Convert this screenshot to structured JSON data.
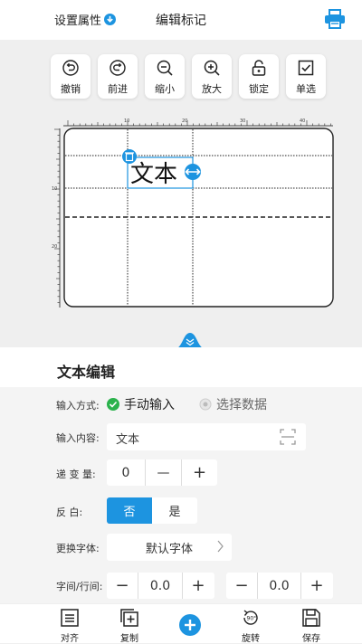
{
  "header": {
    "settings_label": "设置属性",
    "title": "编辑标记"
  },
  "toolbar": [
    {
      "label": "撤销",
      "icon": "undo-icon"
    },
    {
      "label": "前进",
      "icon": "redo-icon"
    },
    {
      "label": "缩小",
      "icon": "zoom-out-icon"
    },
    {
      "label": "放大",
      "icon": "zoom-in-icon"
    },
    {
      "label": "锁定",
      "icon": "lock-icon"
    },
    {
      "label": "单选",
      "icon": "checkbox-icon"
    }
  ],
  "ruler": {
    "top_ticks": [
      "10",
      "20",
      "30",
      "40"
    ],
    "left_ticks": [
      "10",
      "20"
    ]
  },
  "canvas": {
    "text_element": "文本"
  },
  "panel": {
    "title": "文本编辑",
    "input_mode_label": "输入方式:",
    "input_mode_options": [
      "手动输入",
      "选择数据"
    ],
    "input_mode_selected": "手动输入",
    "content_label": "输入内容:",
    "content_value": "文本",
    "increment_label": "递 变 量:",
    "increment_value": "0",
    "invert_label": "反    白:",
    "invert_options": [
      "否",
      "是"
    ],
    "invert_selected": "否",
    "font_label": "更换字体:",
    "font_value": "默认字体",
    "spacing_label": "字间/行间:",
    "char_spacing_value": "0.0",
    "line_spacing_value": "0.0"
  },
  "bottom_bar": {
    "align": "对齐",
    "copy": "复制",
    "rotate": "旋转",
    "rotate_badge": "90°",
    "save": "保存"
  },
  "colors": {
    "accent": "#1d94e0",
    "check_green": "#2bb24c"
  }
}
